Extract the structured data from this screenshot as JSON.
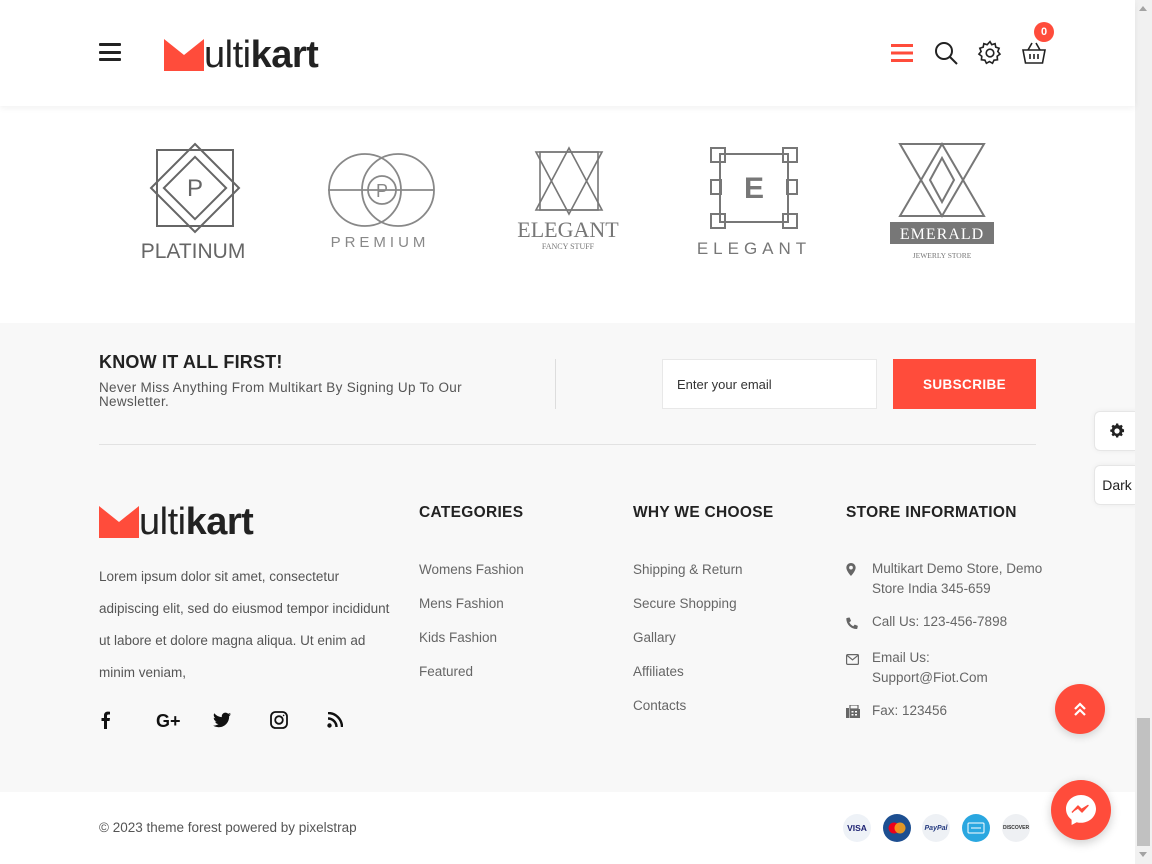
{
  "header": {
    "logo": {
      "prefix": "ulti",
      "bold": "kart"
    },
    "cart_count": "0"
  },
  "brands": [
    {
      "name": "PLATINUM",
      "letter": "P"
    },
    {
      "name": "PREMIUM",
      "letter": "P"
    },
    {
      "name": "ELEGANT",
      "tagline": "FANCY STUFF"
    },
    {
      "name": "ELEGANT",
      "letter": "E"
    },
    {
      "name": "EMERALD",
      "tagline": "JEWERLY STORE"
    }
  ],
  "newsletter": {
    "title": "KNOW IT ALL FIRST!",
    "subtitle": "Never Miss Anything From Multikart By Signing Up To Our Newsletter.",
    "placeholder": "Enter your email",
    "button": "SUBSCRIBE"
  },
  "footer": {
    "logo": {
      "prefix": "ulti",
      "bold": "kart"
    },
    "about": "Lorem ipsum dolor sit amet, consectetur adipiscing elit, sed do eiusmod tempor incididunt ut labore et dolore magna aliqua. Ut enim ad minim veniam,",
    "categories": {
      "title": "CATEGORIES",
      "items": [
        "Womens Fashion",
        "Mens Fashion",
        "Kids Fashion",
        "Featured"
      ]
    },
    "why": {
      "title": "WHY WE CHOOSE",
      "items": [
        "Shipping & Return",
        "Secure Shopping",
        "Gallary",
        "Affiliates",
        "Contacts"
      ]
    },
    "store": {
      "title": "STORE INFORMATION",
      "address": "Multikart Demo Store, Demo Store India 345-659",
      "phone": "Call Us: 123-456-7898",
      "email": "Email Us: Support@Fiot.Com",
      "fax": "Fax: 123456"
    }
  },
  "bottom": {
    "copyright": "© 2023 theme forest powered by pixelstrap",
    "payments": [
      "VISA",
      "mastercard",
      "PayPal",
      "AMEX",
      "DISCOVER"
    ]
  },
  "side": {
    "dark_label": "Dark"
  },
  "colors": {
    "accent": "#ff4c3b",
    "text": "#222222",
    "muted": "#666666",
    "footer_bg": "#f8f8f8"
  }
}
